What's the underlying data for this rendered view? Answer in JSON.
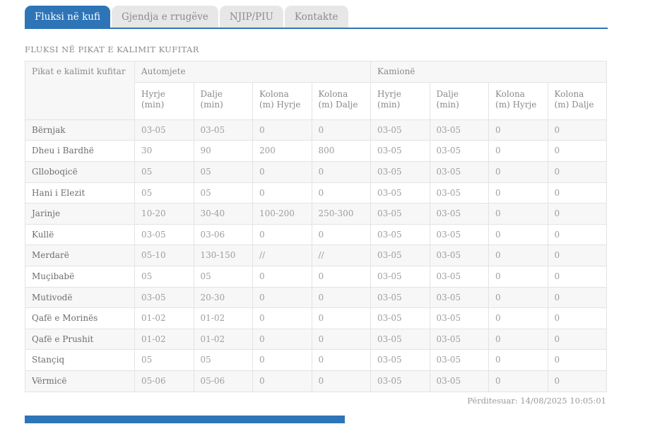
{
  "tabs": [
    {
      "label": "Fluksi në kufi",
      "active": true
    },
    {
      "label": "Gjendja e rrugëve",
      "active": false
    },
    {
      "label": "NJIP/PIU",
      "active": false
    },
    {
      "label": "Kontakte",
      "active": false
    }
  ],
  "heading": "FLUKSI NË PIKAT E KALIMIT KUFITAR",
  "table": {
    "col1_header": "Pikat e kalimit kufitar",
    "groups": [
      {
        "label": "Automjete"
      },
      {
        "label": "Kamionë"
      }
    ],
    "sub_headers": [
      "Hyrje (min)",
      "Dalje (min)",
      "Kolona (m) Hyrje",
      "Kolona (m) Dalje"
    ],
    "rows": [
      {
        "name": "Bërnjak",
        "values": [
          "03-05",
          "03-05",
          "0",
          "0",
          "03-05",
          "03-05",
          "0",
          "0"
        ]
      },
      {
        "name": "Dheu i Bardhë",
        "values": [
          "30",
          "90",
          "200",
          "800",
          "03-05",
          "03-05",
          "0",
          "0"
        ]
      },
      {
        "name": "Glloboqicë",
        "values": [
          "05",
          "05",
          "0",
          "0",
          "03-05",
          "03-05",
          "0",
          "0"
        ]
      },
      {
        "name": "Hani i Elezit",
        "values": [
          "05",
          "05",
          "0",
          "0",
          "03-05",
          "03-05",
          "0",
          "0"
        ]
      },
      {
        "name": "Jarinje",
        "values": [
          "10-20",
          "30-40",
          "100-200",
          "250-300",
          "03-05",
          "03-05",
          "0",
          "0"
        ]
      },
      {
        "name": "Kullë",
        "values": [
          "03-05",
          "03-06",
          "0",
          "0",
          "03-05",
          "03-05",
          "0",
          "0"
        ]
      },
      {
        "name": "Merdarë",
        "values": [
          "05-10",
          "130-150",
          "//",
          "//",
          "03-05",
          "03-05",
          "0",
          "0"
        ]
      },
      {
        "name": "Muçibabë",
        "values": [
          "05",
          "05",
          "0",
          "0",
          "03-05",
          "03-05",
          "0",
          "0"
        ]
      },
      {
        "name": "Mutivodë",
        "values": [
          "03-05",
          "20-30",
          "0",
          "0",
          "03-05",
          "03-05",
          "0",
          "0"
        ]
      },
      {
        "name": "Qafë e Morinës",
        "values": [
          "01-02",
          "01-02",
          "0",
          "0",
          "03-05",
          "03-05",
          "0",
          "0"
        ]
      },
      {
        "name": "Qafë e Prushit",
        "values": [
          "01-02",
          "01-02",
          "0",
          "0",
          "03-05",
          "03-05",
          "0",
          "0"
        ]
      },
      {
        "name": "Stançiq",
        "values": [
          "05",
          "05",
          "0",
          "0",
          "03-05",
          "03-05",
          "0",
          "0"
        ]
      },
      {
        "name": "Vërmicë",
        "values": [
          "05-06",
          "05-06",
          "0",
          "0",
          "03-05",
          "03-05",
          "0",
          "0"
        ]
      }
    ]
  },
  "footer": {
    "updated": "Përditesuar: 14/08/2025 10:05:01"
  },
  "colors": {
    "accent": "#2e75b8",
    "inactive_tab_bg": "#e7e7e7",
    "row_alt_bg": "#f7f7f7",
    "border": "#e3e3e3"
  }
}
